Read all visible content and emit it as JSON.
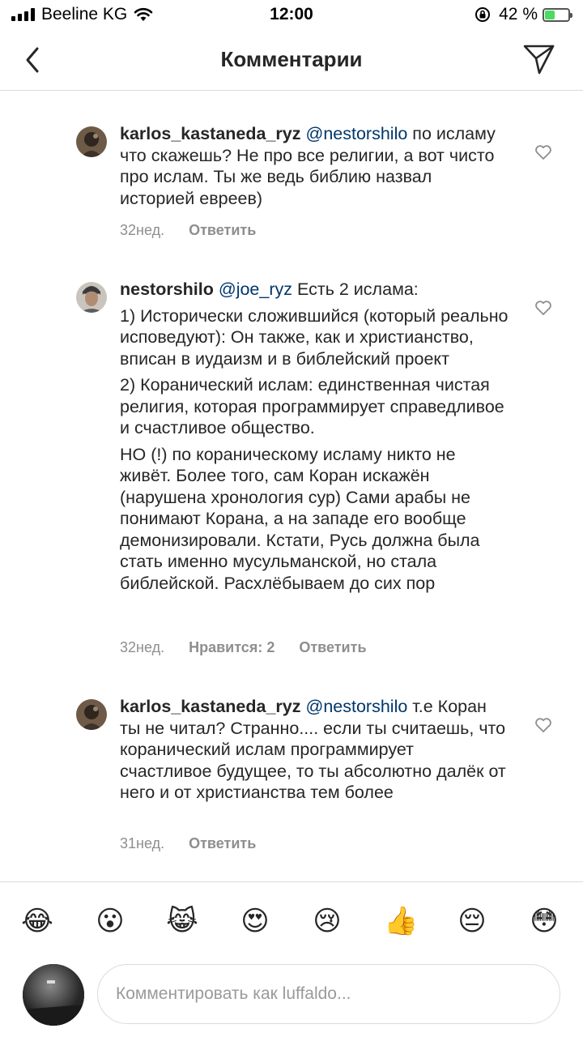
{
  "status_bar": {
    "carrier": "Beeline KG",
    "time": "12:00",
    "battery_percent": "42 %",
    "battery_level": 0.42,
    "battery_color": "#4cd964"
  },
  "nav": {
    "title": "Комментарии",
    "back_icon": "chevron-left-icon",
    "send_icon": "paper-plane-icon"
  },
  "comments": [
    {
      "username": "karlos_kastaneda_ryz",
      "mention": "@nestorshilo",
      "paragraphs": [
        "по исламу что скажешь? Не про все религии, а вот чисто про ислам. Ты же ведь библию назвал историей евреев)"
      ],
      "time": "32нед.",
      "likes": "",
      "reply": "Ответить"
    },
    {
      "username": "nestorshilo",
      "mention": "@joe_ryz",
      "paragraphs": [
        "Есть 2 ислама:",
        "1) Исторически сложившийся (который реально исповедуют): Он также, как и христианство, вписан в иудаизм и в библейский проект",
        "2) Коранический ислам: единственная чистая религия, которая программирует справедливое и счастливое общество.",
        "НО (!) по кораническому исламу никто не живёт. Более того, сам Коран искажён (нарушена хронология сур) Сами арабы не понимают Корана, а на западе его вообще демонизировали. Кстати, Русь должна была стать именно мусульманской, но стала библейской. Расхлёбываем до сих пор"
      ],
      "time": "32нед.",
      "likes": "Нравится: 2",
      "reply": "Ответить"
    },
    {
      "username": "karlos_kastaneda_ryz",
      "mention": "@nestorshilo",
      "paragraphs": [
        "т.е Коран ты не читал? Странно.... если ты считаешь, что коранический ислам программирует счастливое будущее, то ты абсолютно далёк от него и от христианства тем более"
      ],
      "time": "31нед.",
      "likes": "",
      "reply": "Ответить"
    }
  ],
  "emojis": [
    "😂",
    "😮",
    "😹",
    "😍",
    "😢",
    "👍",
    "😔",
    "😳"
  ],
  "input": {
    "placeholder": "Комментировать как luffaldo..."
  },
  "colors": {
    "mention": "#00376b",
    "meta": "#8e8e8e",
    "divider": "#dbdbdb"
  }
}
